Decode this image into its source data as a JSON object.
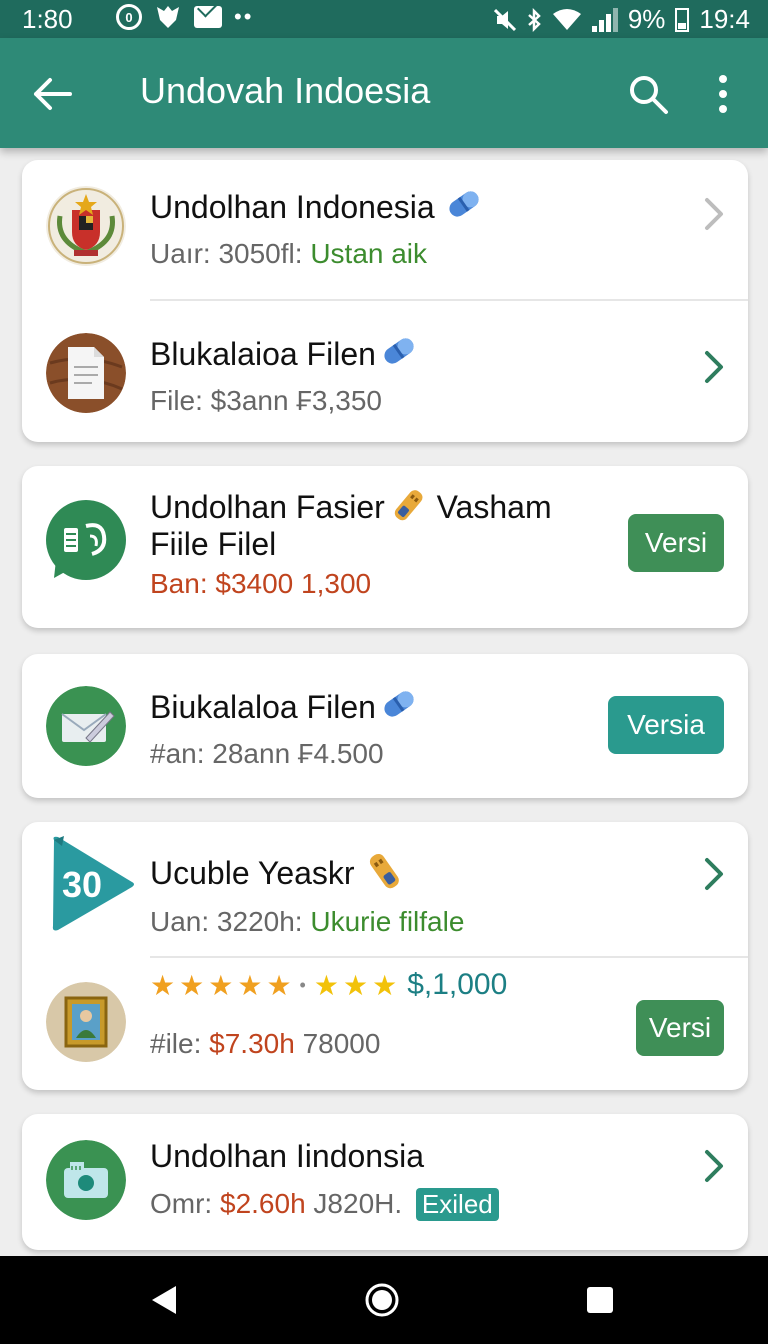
{
  "status_bar": {
    "time_left": "1:80",
    "battery": "9%",
    "time_right": "19:4"
  },
  "app_bar": {
    "title": "Undovah Indoesia"
  },
  "items": [
    {
      "name": "Undolhan Indonesia",
      "sub_prefix": "Uaır: 3050fl:",
      "sub_highlight": "Ustan aik"
    },
    {
      "name": "Blukalaioa Filen",
      "sub_prefix": "File: $3ann ₣3,350"
    },
    {
      "name": "Undolhan Fasier",
      "name_suffix": "Vasham",
      "name_line2": "Fiile Filel",
      "sub_prefix": "Ban: $3400  1,300",
      "button": "Versi"
    },
    {
      "name": "Biukalaloa Filen",
      "sub_prefix": "#an: 28ann ₣4.500",
      "button": "Versia"
    },
    {
      "name": "Ucuble Yeaskr",
      "sub_prefix": "Uan: 3220h:",
      "sub_highlight": "Ukurie filfale",
      "badge": "30"
    },
    {
      "stars_price": "$,1,000",
      "sub_prefix": "#ile:",
      "sub_red": "$7.30h",
      "sub_rest": "78000",
      "button": "Versi"
    },
    {
      "name": "Undolhan Iindonsia",
      "sub_prefix": "Omr:",
      "sub_red": "$2.60h",
      "sub_rest": "J820H.",
      "tag": "Exiled"
    }
  ],
  "colors": {
    "app_bar": "#2e8a77",
    "status_bar": "#1f6b5d",
    "button_green": "#3f8f57",
    "button_teal": "#2a9a8e"
  }
}
